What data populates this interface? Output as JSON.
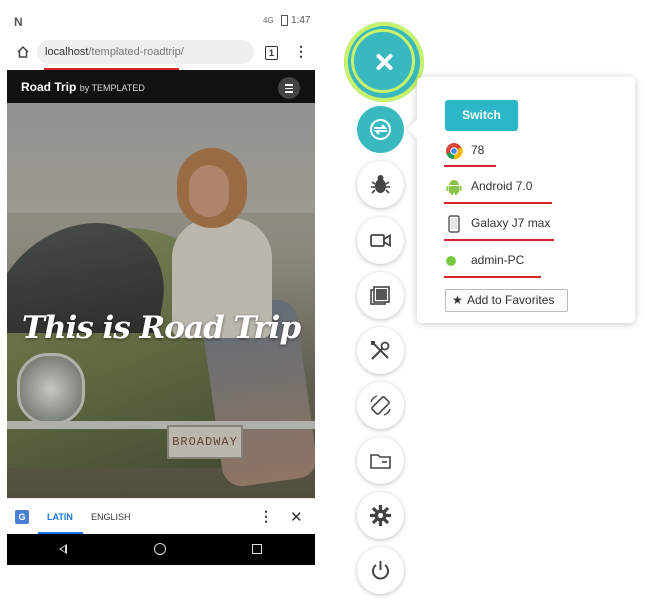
{
  "phone": {
    "status": {
      "carrier_glyph": "N",
      "signal": "4G",
      "time": "1:47"
    },
    "browser": {
      "url_host": "localhost",
      "url_path": "/templated-roadtrip/",
      "tab_count": "1",
      "more_glyph": "⋮"
    },
    "site": {
      "title": "Road Trip",
      "by": "by TEMPLATED",
      "tagline": "This is Road Trip",
      "plate": "BROADWAY"
    },
    "translate": {
      "icon_letter": "G",
      "lang_active": "LATIN",
      "lang_other": "ENGLISH",
      "more_glyph": "⋮",
      "close_glyph": "✕"
    }
  },
  "toolbar": {
    "accent": "#3ab8bf",
    "ring_accent": "#c8f26a",
    "items": [
      "close-icon",
      "switch-device-icon",
      "bug-icon",
      "video-icon",
      "screenshots-icon",
      "tools-icon",
      "rotate-icon",
      "folder-icon",
      "gear-icon",
      "power-icon"
    ]
  },
  "popup": {
    "switch_label": "Switch",
    "browser_version": "78",
    "os": "Android 7.0",
    "device": "Galaxy J7 max",
    "host": "admin-PC",
    "favorites_label": "Add to Favorites",
    "highlight_color": "#d9232e",
    "status_color": "#7ac943"
  }
}
